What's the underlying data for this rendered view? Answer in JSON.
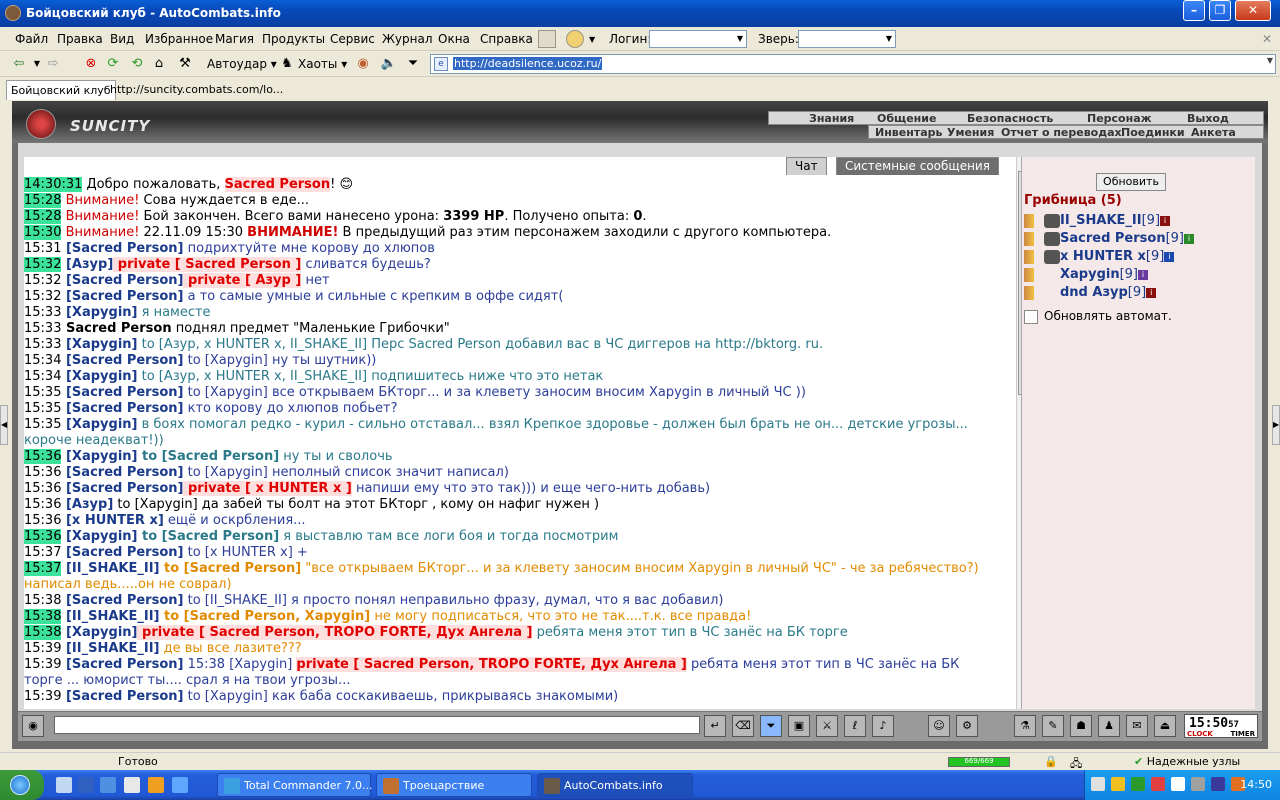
{
  "window": {
    "title": "Бойцовский клуб - AutoCombats.info"
  },
  "menu": {
    "items": [
      "Файл",
      "Правка",
      "Вид",
      "Избранное",
      "Магия",
      "Продукты",
      "Сервис",
      "Журнал",
      "Окна",
      "Справка"
    ],
    "login_label": "Логин:",
    "beast_label": "Зверь:"
  },
  "nav": {
    "autoudar": "Автоудар",
    "haoty": "Хаоты",
    "url": "http://deadsilence.ucoz.ru/"
  },
  "tabs": [
    {
      "label": "Бойцовский клуб"
    },
    {
      "label": "http://suncity.combats.com/lo..."
    }
  ],
  "game": {
    "logo_text": "SUNCITY",
    "topnav": [
      "Знания",
      "Общение",
      "Безопасность",
      "Персонаж",
      "Выход"
    ],
    "subnav": [
      "Инвентарь",
      "Умения",
      "Отчет о переводах",
      "Поединки",
      "Анкета"
    ],
    "chat_tabs": [
      "Чат",
      "Системные сообщения"
    ],
    "clock": {
      "time": "15:50",
      "seconds": "57",
      "label1": "CLOCK",
      "label2": "TIMER"
    }
  },
  "chat": [
    {
      "time": "14:30:31",
      "hl": true,
      "parts": [
        [
          "blk",
          " Добро пожаловать, "
        ],
        [
          "priv",
          "Sacred Person"
        ],
        [
          "blk",
          "! 😊"
        ]
      ]
    },
    {
      "time": "15:28",
      "hl": true,
      "parts": [
        [
          "red",
          " Внимание! "
        ],
        [
          "blk",
          "Сова нуждается в еде..."
        ]
      ]
    },
    {
      "time": "15:28",
      "hl": true,
      "parts": [
        [
          "red",
          " Внимание! "
        ],
        [
          "blk",
          "Бой закончен. Всего вами нанесено урона: "
        ],
        [
          "b",
          "3399 HP"
        ],
        [
          "blk",
          ". Получено опыта: "
        ],
        [
          "b",
          "0"
        ],
        [
          "blk",
          "."
        ]
      ]
    },
    {
      "time": "15:30",
      "hl": true,
      "parts": [
        [
          "red",
          " Внимание! "
        ],
        [
          "blk",
          "22.11.09 15:30 "
        ],
        [
          "redb",
          "ВНИМАНИЕ!"
        ],
        [
          "blk",
          " В предыдущий раз этим персонажем заходили с другого компьютера."
        ]
      ]
    },
    {
      "time": "15:31",
      "hl": false,
      "parts": [
        [
          "n",
          " [Sacred Person]"
        ],
        [
          "bl",
          " подрихтуйте мне корову до хлюпов"
        ]
      ]
    },
    {
      "time": "15:32",
      "hl": true,
      "parts": [
        [
          "n",
          " [Азур]"
        ],
        [
          "priv",
          " private [ Sacred Person ]"
        ],
        [
          "bl",
          " сливатся будешь?"
        ]
      ]
    },
    {
      "time": "15:32",
      "hl": false,
      "parts": [
        [
          "n",
          " [Sacred Person]"
        ],
        [
          "priv",
          " private [ Азур ]"
        ],
        [
          "bl",
          " нет"
        ]
      ]
    },
    {
      "time": "15:32",
      "hl": false,
      "parts": [
        [
          "n",
          " [Sacred Person]"
        ],
        [
          "bl",
          " а то самые умные и сильные с крепким в оффе сидят("
        ]
      ]
    },
    {
      "time": "15:33",
      "hl": false,
      "parts": [
        [
          "n",
          " [Xapygin]"
        ],
        [
          "tl",
          " я наместе"
        ]
      ]
    },
    {
      "time": "15:33",
      "hl": false,
      "parts": [
        [
          "b",
          " Sacred Person"
        ],
        [
          "blk",
          " поднял предмет \"Маленькие Грибочки\""
        ]
      ]
    },
    {
      "time": "15:33",
      "hl": false,
      "parts": [
        [
          "n",
          " [Xapygin]"
        ],
        [
          "tl",
          " to [Азур, x HUNTER x, II_SHAKE_II] Перс Sacred Person добавил вас в ЧС диггеров на http://bktorg. ru."
        ]
      ]
    },
    {
      "time": "15:34",
      "hl": false,
      "parts": [
        [
          "n",
          " [Sacred Person]"
        ],
        [
          "bl",
          " to [Xapygin] ну ты шутник))"
        ]
      ]
    },
    {
      "time": "15:34",
      "hl": false,
      "parts": [
        [
          "n",
          " [Xapygin]"
        ],
        [
          "tl",
          " to [Азур, x HUNTER x, II_SHAKE_II] подпишитесь ниже что это нетак"
        ]
      ]
    },
    {
      "time": "15:35",
      "hl": false,
      "parts": [
        [
          "n",
          " [Sacred Person]"
        ],
        [
          "bl",
          " to [Xapygin] все открываем БКторг... и за клевету заносим вносим Xapygin в личный ЧС ))"
        ]
      ]
    },
    {
      "time": "15:35",
      "hl": false,
      "parts": [
        [
          "n",
          " [Sacred Person]"
        ],
        [
          "bl",
          " кто корову до хлюпов побьет?"
        ]
      ]
    },
    {
      "time": "15:35",
      "hl": false,
      "wrap": true,
      "parts": [
        [
          "n",
          " [Xapygin]"
        ],
        [
          "tl",
          " в боях помогал редко - курил - сильно отставал... взял Крепкое здоровье - должен был брать не он... детские угрозы... короче неадекват!))"
        ]
      ]
    },
    {
      "time": "15:36",
      "hl": true,
      "parts": [
        [
          "n",
          " [Xapygin]"
        ],
        [
          "tlb",
          " to [Sacred Person]"
        ],
        [
          "tl",
          " ну ты и сволочь"
        ]
      ]
    },
    {
      "time": "15:36",
      "hl": false,
      "parts": [
        [
          "n",
          " [Sacred Person]"
        ],
        [
          "bl",
          " to [Xapygin] неполный список значит написал)"
        ]
      ]
    },
    {
      "time": "15:36",
      "hl": false,
      "parts": [
        [
          "n",
          " [Sacred Person]"
        ],
        [
          "priv",
          " private [ x HUNTER x ]"
        ],
        [
          "bl",
          " напиши ему что это так))) и еще чего-нить добавь)"
        ]
      ]
    },
    {
      "time": "15:36",
      "hl": false,
      "parts": [
        [
          "n",
          " [Азур]"
        ],
        [
          "blk",
          " to [Xapygin] да забей ты болт на этот БКторг , кому он нафиг нужен )"
        ]
      ]
    },
    {
      "time": "15:36",
      "hl": false,
      "parts": [
        [
          "n",
          " [x HUNTER x]"
        ],
        [
          "bl",
          " ещё и оскрбления..."
        ]
      ]
    },
    {
      "time": "15:36",
      "hl": true,
      "parts": [
        [
          "n",
          " [Xapygin]"
        ],
        [
          "tlb",
          " to [Sacred Person]"
        ],
        [
          "tl",
          " я выставлю там все логи боя и тогда посмотрим"
        ]
      ]
    },
    {
      "time": "15:37",
      "hl": false,
      "parts": [
        [
          "n",
          " [Sacred Person]"
        ],
        [
          "bl",
          " to [x HUNTER x] +"
        ]
      ]
    },
    {
      "time": "15:37",
      "hl": true,
      "wrap": true,
      "parts": [
        [
          "n",
          " [II_SHAKE_II]"
        ],
        [
          "orb",
          " to [Sacred Person]"
        ],
        [
          "or",
          " \"все открываем БКторг... и за клевету заносим вносим Xapygin в личный ЧС\" - че за ребячество?) написал ведь.....он не соврал)"
        ]
      ]
    },
    {
      "time": "15:38",
      "hl": false,
      "parts": [
        [
          "n",
          " [Sacred Person]"
        ],
        [
          "bl",
          " to [II_SHAKE_II] я просто понял неправильно фразу, думал, что я вас добавил)"
        ]
      ]
    },
    {
      "time": "15:38",
      "hl": true,
      "parts": [
        [
          "n",
          " [II_SHAKE_II]"
        ],
        [
          "orb",
          " to [Sacred Person, Xapygin]"
        ],
        [
          "or",
          " не могу подписаться, что это не так....т.к. все правда!"
        ]
      ]
    },
    {
      "time": "15:38",
      "hl": true,
      "parts": [
        [
          "n",
          " [Xapygin]"
        ],
        [
          "priv",
          " private [ Sacred Person, TROPO FORTE, Дух Ангела ]"
        ],
        [
          "tl",
          " ребята меня этот тип в ЧС занёс на БК торге"
        ]
      ]
    },
    {
      "time": "15:39",
      "hl": false,
      "parts": [
        [
          "n",
          " [II_SHAKE_II]"
        ],
        [
          "or",
          " де вы все лазите???"
        ]
      ]
    },
    {
      "time": "15:39",
      "hl": false,
      "wrap": true,
      "parts": [
        [
          "n",
          " [Sacred Person]"
        ],
        [
          "bl",
          " 15:38 [Xapygin] "
        ],
        [
          "priv",
          "private [ Sacred Person, TROPO FORTE, Дух Ангела ]"
        ],
        [
          "bl",
          " ребята меня этот тип в ЧС занёс на БК торге ... юморист ты.... срал я на твои угрозы..."
        ]
      ]
    },
    {
      "time": "15:39",
      "hl": false,
      "parts": [
        [
          "n",
          " [Sacred Person]"
        ],
        [
          "bl",
          " to [Xapygin] как баба соскакиваешь, прикрываясь знакомыми)"
        ]
      ]
    }
  ],
  "sidebar": {
    "refresh_label": "Обновить",
    "room_title": "Грибница (5)",
    "users": [
      {
        "name": "II_SHAKE_II",
        "level": "[9]",
        "info_color": "#8a1010"
      },
      {
        "name": "Sacred Person",
        "level": "[9]",
        "info_color": "#2a8a2a"
      },
      {
        "name": "x HUNTER x",
        "level": "[9]",
        "info_color": "#1a4ab0"
      },
      {
        "name": "Xapygin",
        "level": "[9]",
        "info_color": "#6a3aa0"
      },
      {
        "name": "dnd Азур",
        "level": "[9]",
        "info_color": "#8a1010"
      }
    ],
    "auto_refresh_label": "Обновлять автомат."
  },
  "status": {
    "text": "Готово",
    "progress_label": "669/669",
    "progress_fraction": 1.0,
    "reliable_label": "Надежные узлы"
  },
  "taskbar": {
    "tasks": [
      "Total Commander 7.0...",
      "Троецарствие",
      "AutoCombats.info"
    ],
    "time": "14:50"
  }
}
